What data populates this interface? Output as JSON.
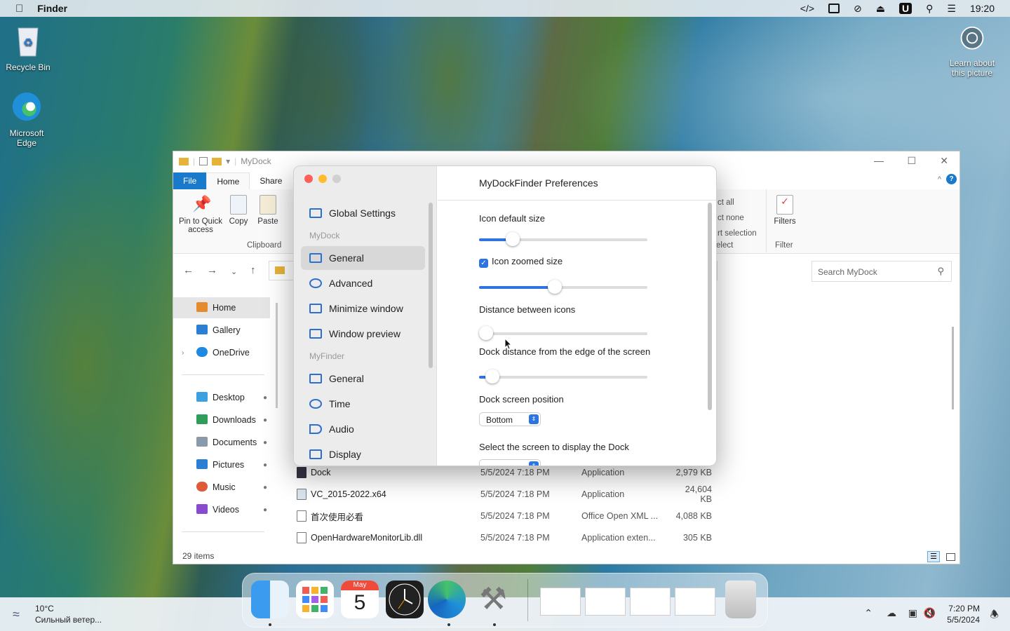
{
  "menubar": {
    "apple": "",
    "app": "Finder",
    "time": "19:20"
  },
  "desktop": {
    "recycle_bin": "Recycle Bin",
    "edge_line1": "Microsoft",
    "edge_line2": "Edge",
    "learn_line1": "Learn about",
    "learn_line2": "this picture"
  },
  "explorer": {
    "title": "MyDock",
    "tabs": [
      "File",
      "Home",
      "Share"
    ],
    "ribbon": {
      "pin_line1": "Pin to Quick",
      "pin_line2": "access",
      "copy": "Copy",
      "paste": "Paste",
      "clipboard_group": "Clipboard",
      "select_all": "ct all",
      "select_none": "ct none",
      "invert_selection": "rt selection",
      "select_group": "elect",
      "filters": "Filters",
      "filter_group": "Filter"
    },
    "search_placeholder": "Search MyDock",
    "sidebar": [
      {
        "label": "Home"
      },
      {
        "label": "Gallery"
      },
      {
        "label": "OneDrive"
      },
      {
        "label": "Desktop"
      },
      {
        "label": "Downloads"
      },
      {
        "label": "Documents"
      },
      {
        "label": "Pictures"
      },
      {
        "label": "Music"
      },
      {
        "label": "Videos"
      }
    ],
    "files": [
      {
        "name": "Dock",
        "date": "5/5/2024 7:18 PM",
        "type": "Application",
        "size": "2,979 KB"
      },
      {
        "name": "VC_2015-2022.x64",
        "date": "5/5/2024 7:18 PM",
        "type": "Application",
        "size": "24,604 KB"
      },
      {
        "name": "首次使用必看",
        "date": "5/5/2024 7:18 PM",
        "type": "Office Open XML ...",
        "size": "4,088 KB"
      },
      {
        "name": "OpenHardwareMonitorLib.dll",
        "date": "5/5/2024 7:18 PM",
        "type": "Application exten...",
        "size": "305 KB"
      }
    ],
    "status": "29 items"
  },
  "prefs": {
    "title": "MyDockFinder Preferences",
    "global": "Global Settings",
    "section_mydock": "MyDock",
    "section_myfinder": "MyFinder",
    "nav_mydock": [
      "General",
      "Advanced",
      "Minimize window",
      "Window preview"
    ],
    "nav_myfinder": [
      "General",
      "Time",
      "Audio",
      "Display"
    ],
    "icon_default_size": "Icon default size",
    "icon_default_value": 0.2,
    "icon_zoomed_size": "Icon zoomed size",
    "icon_zoomed_checked": true,
    "icon_zoomed_value": 0.45,
    "distance_between_icons": "Distance between icons",
    "distance_value": 0.04,
    "dock_distance": "Dock distance from the edge of the screen",
    "dock_distance_value": 0.08,
    "dock_screen_position": "Dock screen position",
    "dock_position_value": "Bottom",
    "select_screen": "Select the screen to display the Dock"
  },
  "dock": {
    "calendar_month": "May",
    "calendar_day": "5"
  },
  "taskbar": {
    "temp": "10°C",
    "weather": "Сильный ветер...",
    "time": "7:20 PM",
    "date": "5/5/2024"
  },
  "colors": {
    "accent": "#2e74e0",
    "file_tab": "#1979ca"
  }
}
